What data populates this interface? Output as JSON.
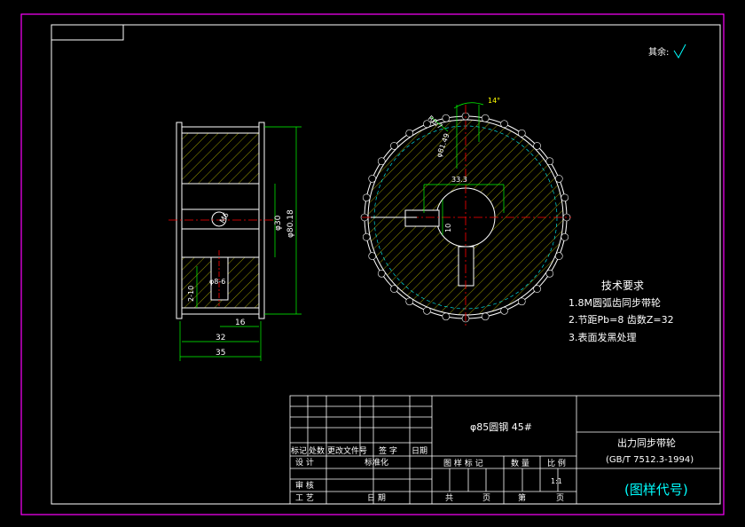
{
  "roughness": {
    "label": "其余:"
  },
  "side_view": {
    "dim_width": "35",
    "dim_hub": "32",
    "dim_inner": "16",
    "dim_od": "φ80.18",
    "dim_bore": "φ30",
    "dim_keyway": "φ8-6",
    "dim_hole": "2-10",
    "dim_center": "M6"
  },
  "front_view": {
    "angle_label": "14°",
    "dim_tooth": "R0.7",
    "dim_pitch": "φ81.49",
    "dim_key_height": "33.3",
    "dim_key_width": "10"
  },
  "tech_requirements": {
    "title": "技术要求",
    "items": [
      "1.8M圆弧齿同步带轮",
      "2.节距Pb=8  齿数Z=32",
      "3.表面发黑处理"
    ]
  },
  "title_block": {
    "material": "φ85圆钢  45#",
    "part_name": "出力同步带轮",
    "standard": "(GB/T 7512.3-1994)",
    "drawing_code": "(图样代号)",
    "revision_headers": [
      "标记",
      "处数",
      "更改文件号",
      "签  字",
      "日期"
    ],
    "design": "设  计",
    "standardize": "标准化",
    "review": "审  核",
    "process": "工  艺",
    "date": "日 期",
    "mark": "图 样 标 记",
    "weight": "数 量",
    "scale": "比 例",
    "scale_value": "1:1",
    "total": "共",
    "sheet": "第",
    "page": "页",
    "page2": "页"
  },
  "colors": {
    "border": "#ff00ff",
    "lines": "#ffffff",
    "green": "#00ff00",
    "cyan": "#00ffff",
    "red": "#ff0000",
    "yellow": "#ffff00",
    "hatch": "#ffff00"
  }
}
